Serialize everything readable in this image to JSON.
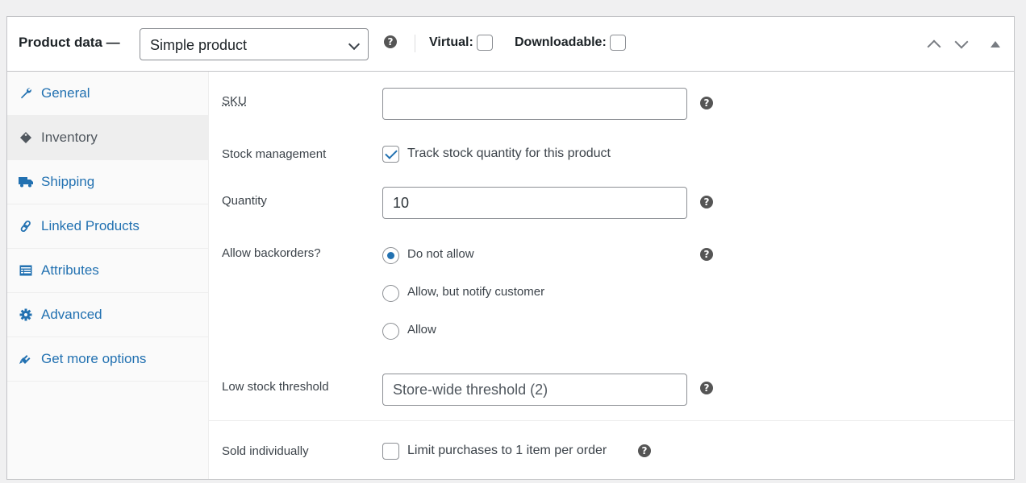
{
  "header": {
    "title": "Product data —",
    "product_type": "Simple product",
    "help_icon": "question-circle-icon",
    "virtual_label": "Virtual:",
    "virtual_checked": false,
    "downloadable_label": "Downloadable:",
    "downloadable_checked": false,
    "controls": [
      "move-up-icon",
      "move-down-icon",
      "collapse-toggle-icon"
    ]
  },
  "sidebar": {
    "items": [
      {
        "label": "General",
        "icon": "wrench-icon",
        "glyph": "🔧",
        "active": false
      },
      {
        "label": "Inventory",
        "icon": "tag-icon",
        "glyph": "◆",
        "active": true
      },
      {
        "label": "Shipping",
        "icon": "truck-icon",
        "glyph": "■",
        "active": false
      },
      {
        "label": "Linked Products",
        "icon": "link-icon",
        "glyph": "∞",
        "active": false
      },
      {
        "label": "Attributes",
        "icon": "list-card-icon",
        "glyph": "▤",
        "active": false
      },
      {
        "label": "Advanced",
        "icon": "gear-icon",
        "glyph": "⚙",
        "active": false
      },
      {
        "label": "Get more options",
        "icon": "plugin-icon",
        "glyph": "➘",
        "active": false
      }
    ]
  },
  "form": {
    "sku": {
      "label": "SKU",
      "value": ""
    },
    "stock_management": {
      "label": "Stock management",
      "checkbox_label": "Track stock quantity for this product",
      "checked": true
    },
    "quantity": {
      "label": "Quantity",
      "value": "10"
    },
    "backorders": {
      "label": "Allow backorders?",
      "options": [
        {
          "label": "Do not allow",
          "selected": true
        },
        {
          "label": "Allow, but notify customer",
          "selected": false
        },
        {
          "label": "Allow",
          "selected": false
        }
      ]
    },
    "low_stock": {
      "label": "Low stock threshold",
      "placeholder": "Store-wide threshold (2)",
      "value": ""
    },
    "sold_individually": {
      "label": "Sold individually",
      "checkbox_label": "Limit purchases to 1 item per order",
      "checked": false
    }
  },
  "help_glyph": "?",
  "colors": {
    "link": "#2271b1",
    "active_tab_bg": "#eeeeee",
    "border": "#c3c4c7"
  }
}
